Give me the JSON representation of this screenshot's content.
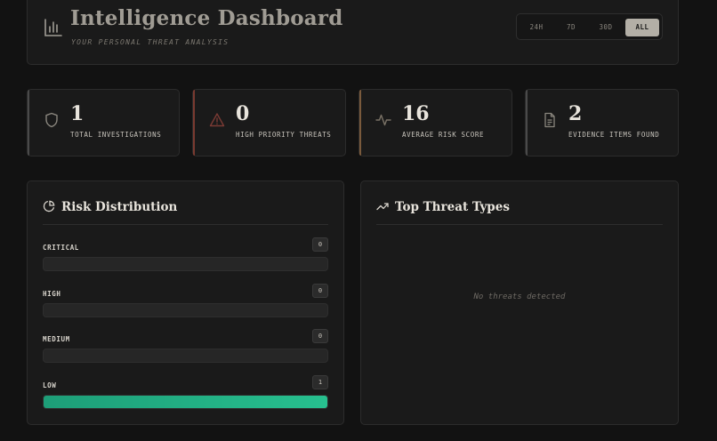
{
  "header": {
    "title": "Intelligence Dashboard",
    "subtitle": "YOUR PERSONAL THREAT ANALYSIS",
    "icon": "bar-chart-icon",
    "ranges": [
      {
        "label": "24H",
        "active": false
      },
      {
        "label": "7D",
        "active": false
      },
      {
        "label": "30D",
        "active": false
      },
      {
        "label": "ALL",
        "active": true
      }
    ]
  },
  "stats": [
    {
      "value": "1",
      "label": "TOTAL INVESTIGATIONS",
      "icon": "shield-icon",
      "accent": "#4a4a4a"
    },
    {
      "value": "0",
      "label": "HIGH PRIORITY THREATS",
      "icon": "warning-icon",
      "accent": "#7a3a30"
    },
    {
      "value": "16",
      "label": "AVERAGE RISK SCORE",
      "icon": "activity-icon",
      "accent": "#7a5a3c"
    },
    {
      "value": "2",
      "label": "EVIDENCE ITEMS FOUND",
      "icon": "document-icon",
      "accent": "#4a4a4a"
    }
  ],
  "risk_distribution": {
    "title": "Risk Distribution",
    "icon": "pie-chart-icon",
    "levels": [
      {
        "label": "CRITICAL",
        "count": "0",
        "fraction": 0
      },
      {
        "label": "HIGH",
        "count": "0",
        "fraction": 0
      },
      {
        "label": "MEDIUM",
        "count": "0",
        "fraction": 0
      },
      {
        "label": "LOW",
        "count": "1",
        "fraction": 1
      }
    ],
    "fill_color": "#22b085"
  },
  "top_threats": {
    "title": "Top Threat Types",
    "icon": "trending-up-icon",
    "empty_message": "No threats detected"
  }
}
